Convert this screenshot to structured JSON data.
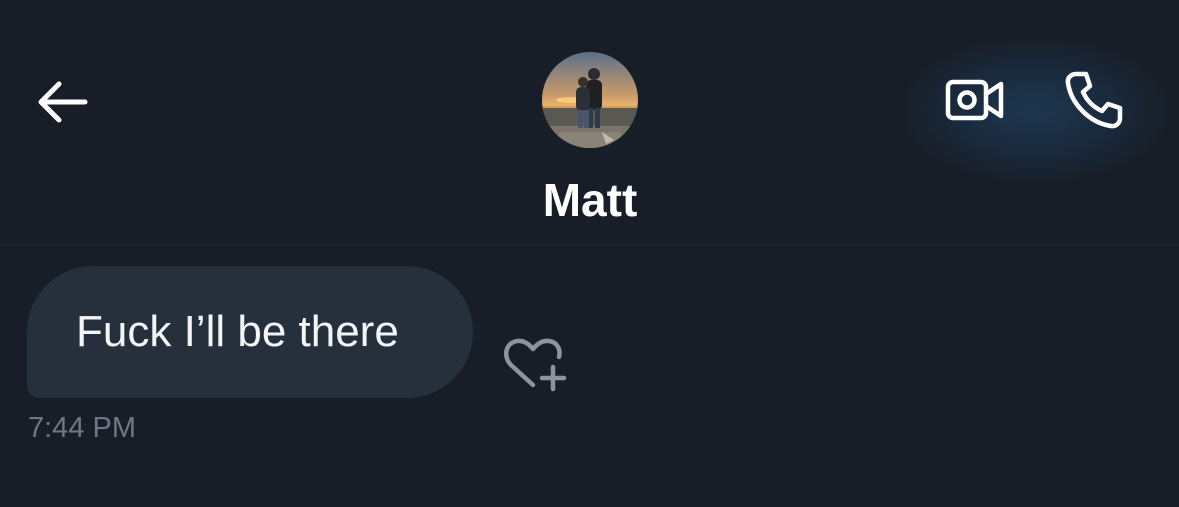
{
  "header": {
    "contact_name": "Matt",
    "back_icon": "arrow-left-icon",
    "avatar": "profile-photo",
    "video_icon": "video-camera-icon",
    "call_icon": "phone-icon"
  },
  "messages": [
    {
      "text": "Fuck I’ll be there",
      "time": "7:44 PM",
      "direction": "received",
      "react_icon": "heart-plus-icon"
    }
  ],
  "colors": {
    "background": "#171e27",
    "bubble": "#26303d",
    "text_primary": "#ffffff",
    "text_muted": "#6e7884",
    "icon_muted": "#8b95a1"
  }
}
